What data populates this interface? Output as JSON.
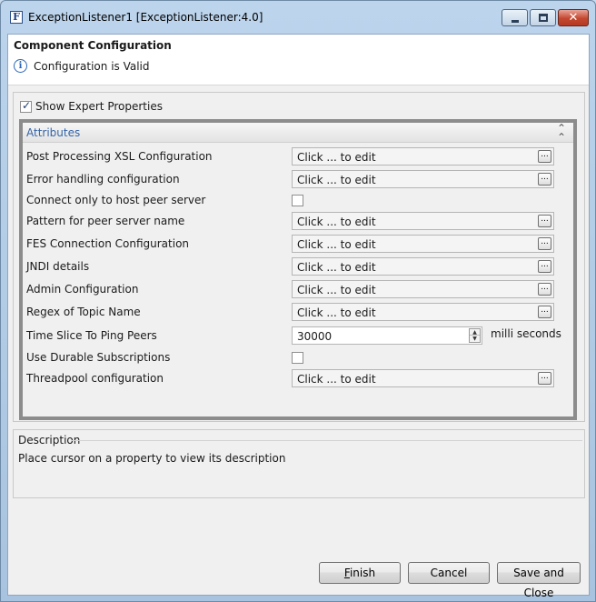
{
  "window": {
    "app_icon_letter": "F",
    "title": "ExceptionListener1 [ExceptionListener:4.0]",
    "close_glyph": "✕"
  },
  "header": {
    "title": "Component Configuration",
    "info_glyph": "i",
    "status": "Configuration is Valid"
  },
  "expert": {
    "label": "Show Expert Properties",
    "checked": true
  },
  "attributes": {
    "title": "Attributes",
    "collapse_glyph": "⌃",
    "rows": [
      {
        "label": "Post Processing XSL Configuration",
        "kind": "edit",
        "value": "Click ... to edit",
        "button": "..."
      },
      {
        "label": "Error handling configuration",
        "kind": "edit",
        "value": "Click ... to edit",
        "button": "..."
      },
      {
        "label": "Connect only to host peer server",
        "kind": "checkbox",
        "checked": false
      },
      {
        "label": "Pattern for peer server name",
        "kind": "edit",
        "value": "Click ... to edit",
        "button": "..."
      },
      {
        "label": "FES Connection Configuration",
        "kind": "edit",
        "value": "Click ... to edit",
        "button": "..."
      },
      {
        "label": "JNDI details",
        "kind": "edit",
        "value": "Click ... to edit",
        "button": "..."
      },
      {
        "label": "Admin Configuration",
        "kind": "edit",
        "value": "Click ... to edit",
        "button": "..."
      },
      {
        "label": "Regex of Topic Name",
        "kind": "edit",
        "value": "Click ... to edit",
        "button": "..."
      },
      {
        "label": "Time Slice To Ping Peers",
        "kind": "spinner",
        "value": "30000",
        "unit": "milli seconds",
        "up_glyph": "▲",
        "down_glyph": "▼"
      },
      {
        "label": "Use Durable Subscriptions",
        "kind": "checkbox",
        "checked": false
      },
      {
        "label": "Threadpool configuration",
        "kind": "edit",
        "value": "Click ... to edit",
        "button": "..."
      }
    ]
  },
  "description": {
    "title": "Description",
    "text": "Place cursor on a property to view its description"
  },
  "buttons": {
    "finish_mnemonic": "F",
    "finish_rest": "inish",
    "cancel": "Cancel",
    "save_close": "Save and Close"
  }
}
